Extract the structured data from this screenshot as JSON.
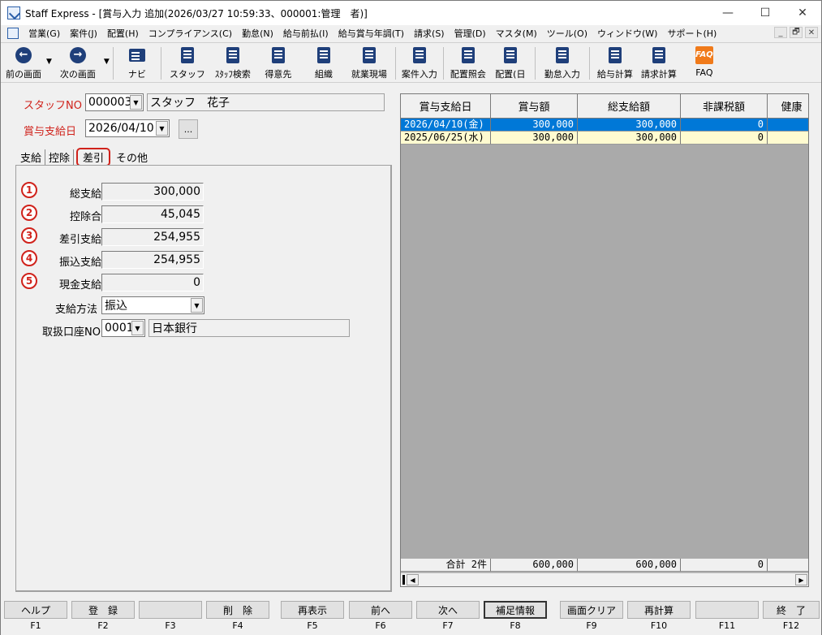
{
  "window": {
    "title": "Staff Express - [賞与入力  追加(2026/03/27 10:59:33、000001:管理　者)]",
    "controls": [
      "—",
      "☐",
      "✕"
    ]
  },
  "menu": [
    "営業(G)",
    "案件(J)",
    "配置(H)",
    "コンプライアンス(C)",
    "勤怠(N)",
    "給与前払(I)",
    "給与賞与年調(T)",
    "請求(S)",
    "管理(D)",
    "マスタ(M)",
    "ツール(O)",
    "ウィンドウ(W)",
    "サポート(H)"
  ],
  "mdi_controls": [
    "_",
    "🗗",
    "✕"
  ],
  "toolbar": {
    "prev": "前の画面",
    "next": "次の画面",
    "navi": "ナビ",
    "staff": "スタッフ",
    "staff_search": "ｽﾀｯﾌ検索",
    "customer": "得意先",
    "organization": "組織",
    "worksite": "就業現場",
    "job_entry": "案件入力",
    "assign_lookup": "配置照会",
    "assign_day": "配置(日",
    "attendance": "勤怠入力",
    "payroll_calc": "給与計算",
    "billing_calc": "請求計算",
    "faq": "FAQ",
    "faq_icon_text": "FAQ"
  },
  "header": {
    "staff_no_label": "スタッフNO",
    "staff_no": "000003",
    "staff_name": "スタッフ　花子",
    "pay_date_label": "賞与支給日",
    "pay_date": "2026/04/10",
    "ellipsis": "..."
  },
  "tabs": [
    "支給",
    "控除",
    "差引",
    "その他"
  ],
  "summary": {
    "rows": [
      {
        "num": "1",
        "label": "総支給額",
        "value": "300,000"
      },
      {
        "num": "2",
        "label": "控除合計",
        "value": "45,045"
      },
      {
        "num": "3",
        "label": "差引支給額",
        "value": "254,955"
      },
      {
        "num": "4",
        "label": "振込支給額",
        "value": "254,955"
      },
      {
        "num": "5",
        "label": "現金支給額",
        "value": "0"
      }
    ],
    "payment_method_label": "支給方法",
    "payment_method": "振込",
    "account_label": "取扱口座NO",
    "account_no": "0001",
    "bank_name": "日本銀行"
  },
  "grid": {
    "columns": [
      "賞与支給日",
      "賞与額",
      "総支給額",
      "非課税額",
      "健康"
    ],
    "rows": [
      [
        "2026/04/10(金)",
        "300,000",
        "300,000",
        "0",
        ""
      ],
      [
        "2025/06/25(水)",
        "300,000",
        "300,000",
        "0",
        ""
      ]
    ],
    "footer": [
      "合計 2件",
      "600,000",
      "600,000",
      "0",
      ""
    ]
  },
  "fkeys": [
    {
      "label": "ヘルプ",
      "key": "F1"
    },
    {
      "label": "登　録",
      "key": "F2"
    },
    {
      "label": "",
      "key": "F3"
    },
    {
      "label": "削　除",
      "key": "F4"
    },
    {
      "label": "再表示",
      "key": "F5"
    },
    {
      "label": "前へ",
      "key": "F6"
    },
    {
      "label": "次へ",
      "key": "F7"
    },
    {
      "label": "補足情報",
      "key": "F8"
    },
    {
      "label": "画面クリア",
      "key": "F9"
    },
    {
      "label": "再計算",
      "key": "F10"
    },
    {
      "label": "",
      "key": "F11"
    },
    {
      "label": "終　了",
      "key": "F12"
    }
  ]
}
